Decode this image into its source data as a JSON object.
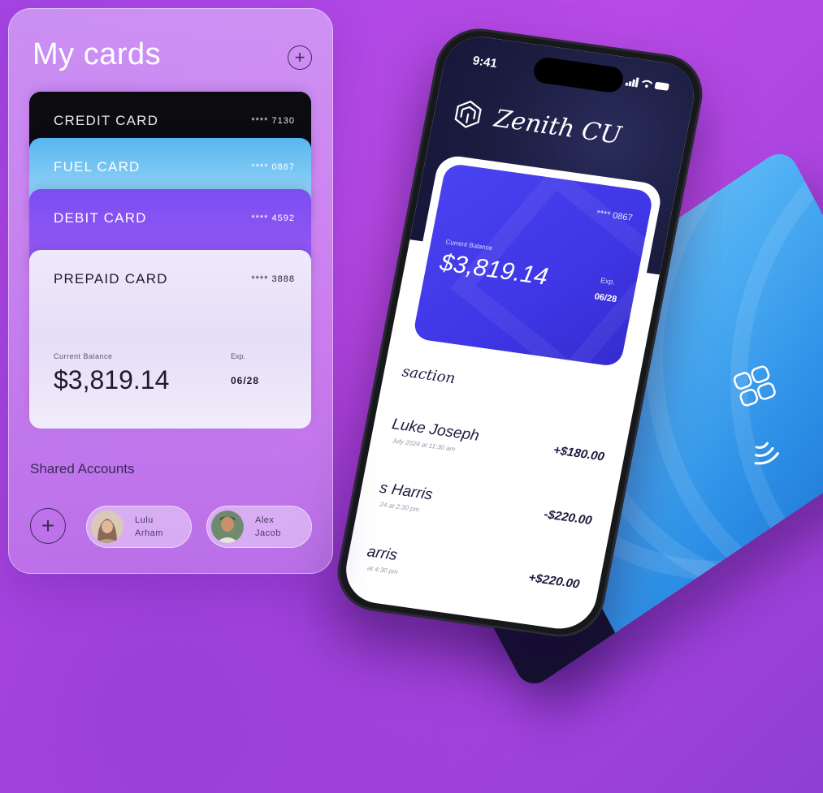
{
  "glass_panel": {
    "title": "My cards",
    "cards": [
      {
        "label": "CREDIT CARD",
        "number": "**** 7130"
      },
      {
        "label": "FUEL CARD",
        "number": "**** 0867"
      },
      {
        "label": "DEBIT CARD",
        "number": "**** 4592"
      },
      {
        "label": "PREPAID CARD",
        "number": "**** 3888",
        "balance_label": "Current Balance",
        "balance": "$3,819.14",
        "exp_label": "Exp.",
        "exp": "06/28"
      }
    ],
    "shared": {
      "title": "Shared Accounts",
      "add_icon": "plus-icon",
      "members": [
        {
          "first": "Lulu",
          "last": "Arham"
        },
        {
          "first": "Alex",
          "last": "Jacob"
        }
      ]
    }
  },
  "phone": {
    "status_time": "9:41",
    "status_icons": "signal wifi battery",
    "brand": "Zenith CU",
    "card": {
      "number": "**** 0867",
      "balance_label": "Current Balance",
      "balance": "$3,819.14",
      "exp_label": "Exp.",
      "exp": "06/28"
    },
    "transactions_heading": "saction",
    "transactions": [
      {
        "name": "Luke Joseph",
        "date": "July 2024 at 11:30 am",
        "amount": "+$180.00"
      },
      {
        "name": "s Harris",
        "date": "24 at 2:30 pm",
        "amount": "-$220.00"
      },
      {
        "name": "arris",
        "date": "at 4:30 pm",
        "amount": "+$220.00"
      }
    ]
  },
  "colors": {
    "background": "#b046e4",
    "phone_card": "#3f36e6",
    "bank_card": "#4fb0f4",
    "dark_navy": "#1b1c3f"
  }
}
